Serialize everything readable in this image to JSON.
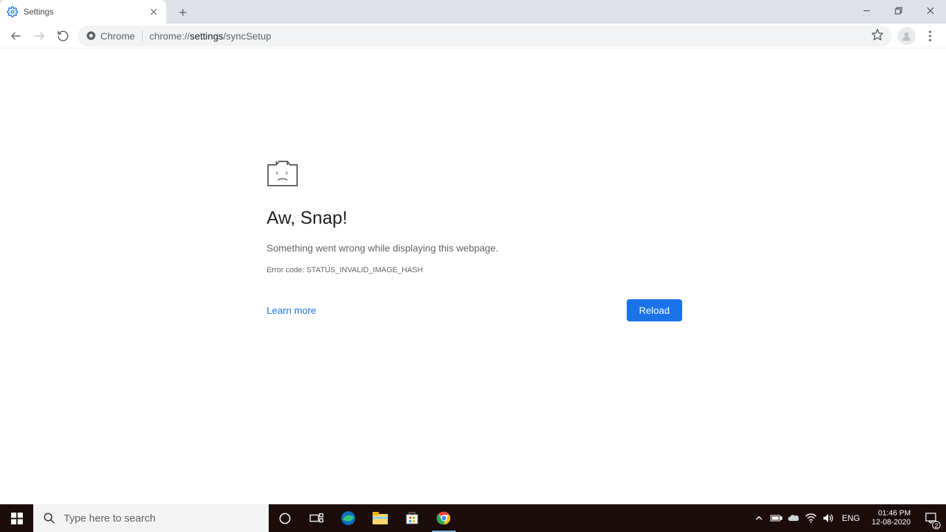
{
  "tab": {
    "title": "Settings"
  },
  "omnibox": {
    "chip_label": "Chrome",
    "url_prefix": "chrome://",
    "url_bold": "settings",
    "url_suffix": "/syncSetup"
  },
  "error": {
    "heading": "Aw, Snap!",
    "message": "Something went wrong while displaying this webpage.",
    "code": "Error code: STATUS_INVALID_IMAGE_HASH",
    "learn_more": "Learn more",
    "reload": "Reload"
  },
  "taskbar": {
    "search_placeholder": "Type here to search",
    "lang": "ENG",
    "time": "01:46 PM",
    "date": "12-08-2020",
    "notification_count": "2"
  }
}
